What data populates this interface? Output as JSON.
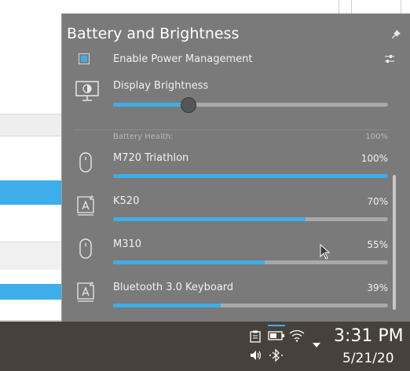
{
  "popup": {
    "title": "Battery and Brightness",
    "power_management_label": "Enable Power Management",
    "power_management_checked": true,
    "brightness_label": "Display Brightness",
    "brightness_level": 0.27,
    "health_label": "Battery Health:",
    "health_value": "100%"
  },
  "devices": [
    {
      "name": "M720 Triathlon",
      "percent": "100%",
      "level": 1.0,
      "icon": "mouse-icon"
    },
    {
      "name": "K520",
      "percent": "70%",
      "level": 0.7,
      "icon": "keyboard-icon"
    },
    {
      "name": "M310",
      "percent": "55%",
      "level": 0.55,
      "icon": "mouse-icon"
    },
    {
      "name": "Bluetooth 3.0 Keyboard",
      "percent": "39%",
      "level": 0.39,
      "icon": "keyboard-icon"
    }
  ],
  "taskbar": {
    "time": "3:31 PM",
    "date": "5/21/20",
    "tray_icons": [
      "clipboard-icon",
      "battery-icon",
      "wifi-icon",
      "expand-icon",
      "volume-icon",
      "bluetooth-icon"
    ]
  },
  "colors": {
    "accent": "#3daee9",
    "popup_bg": "#7a7a7a",
    "taskbar_bg": "#46413a",
    "selection": "#3daee9"
  }
}
